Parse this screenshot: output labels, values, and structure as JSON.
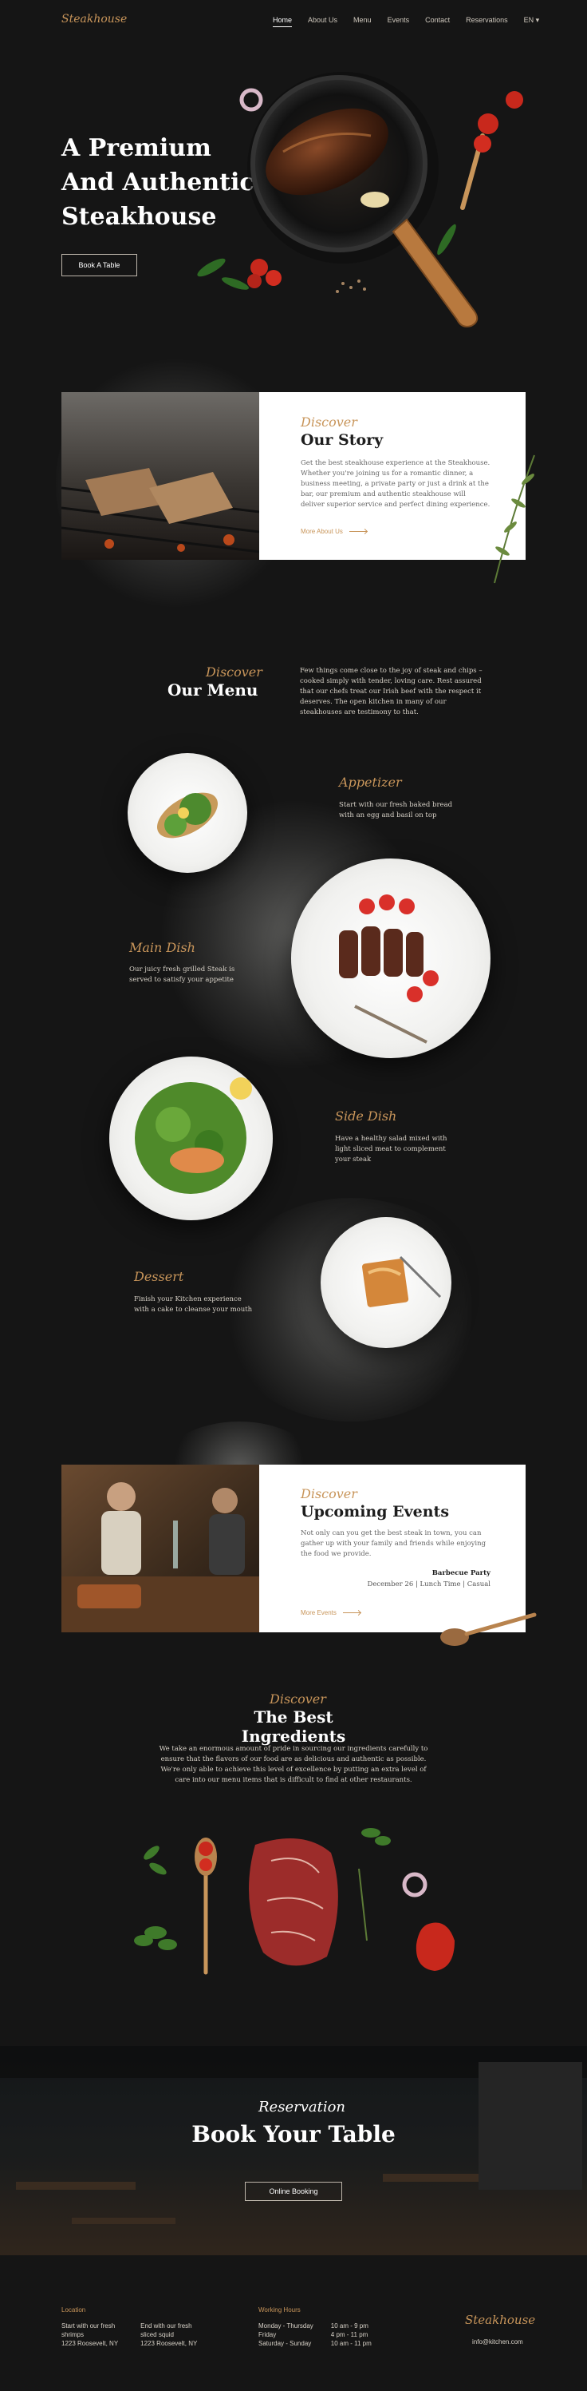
{
  "header": {
    "logo": "Steakhouse",
    "nav": [
      "Home",
      "About Us",
      "Menu",
      "Events",
      "Contact",
      "Reservations",
      "EN ▾"
    ]
  },
  "hero": {
    "title_lines": [
      "A Premium",
      "And Authentic",
      "Steakhouse"
    ],
    "cta": "Book A Table"
  },
  "story": {
    "kicker": "Discover",
    "title": "Our Story",
    "text": "Get the best steakhouse experience at the Steakhouse. Whether you're joining us for a romantic dinner, a business meeting, a private party or just a drink at the bar, our premium and authentic steakhouse will deliver superior service and perfect dining experience.",
    "link": "More About Us"
  },
  "menu": {
    "kicker": "Discover",
    "title": "Our Menu",
    "intro": "Few things come close to the joy of steak and chips – cooked simply with tender, loving care. Rest assured that our chefs treat our Irish beef with the respect it deserves. The open kitchen in many of our steakhouses are testimony to that.",
    "dishes": [
      {
        "name": "Appetizer",
        "desc": "Start with our fresh baked bread with an egg and basil on top"
      },
      {
        "name": "Main Dish",
        "desc": "Our juicy fresh grilled Steak is served to satisfy your appetite"
      },
      {
        "name": "Side Dish",
        "desc": "Have a healthy salad mixed with light sliced meat to complement your steak"
      },
      {
        "name": "Dessert",
        "desc": "Finish your Kitchen experience with a cake to cleanse your mouth"
      }
    ]
  },
  "events": {
    "kicker": "Discover",
    "title": "Upcoming Events",
    "text": "Not only can you get the best steak in town, you can gather up with your family and friends while enjoying the food we provide.",
    "event_name": "Barbecue Party",
    "event_meta": "December 26 | Lunch Time | Casual",
    "link": "More Events"
  },
  "ingredients": {
    "kicker": "Discover",
    "title": "The Best Ingredients",
    "text": "We take an enormous amount of pride in sourcing our ingredients carefully to ensure that the flavors of our food are as delicious and authentic as possible. We're only able to achieve this level of excellence by putting an extra level of care into our menu items that is difficult to find at other restaurants."
  },
  "reservation": {
    "kicker": "Reservation",
    "title": "Book Your Table",
    "cta": "Online Booking"
  },
  "footer": {
    "location_label": "Location",
    "loc1": [
      "Start with our fresh",
      "shrimps",
      "1223 Roosevelt, NY"
    ],
    "loc2": [
      "End with our fresh",
      "sliced squid",
      "1223 Roosevelt, NY"
    ],
    "hours_label": "Working Hours",
    "days": [
      "Monday - Thursday",
      "Friday",
      "Saturday - Sunday"
    ],
    "times": [
      "10 am - 9 pm",
      "4 pm - 11 pm",
      "10 am - 11 pm"
    ],
    "logo": "Steakhouse",
    "email": "info@kitchen.com"
  }
}
